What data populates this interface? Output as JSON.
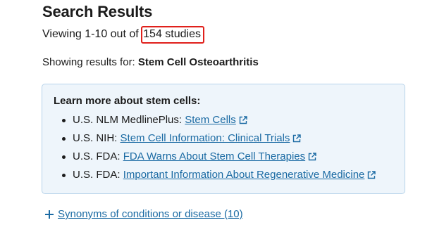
{
  "page": {
    "title": "Search Results",
    "viewing_prefix": "Viewing 1-10 out of",
    "study_count": "154 studies",
    "showing_prefix": "Showing results for:",
    "query": "Stem Cell Osteoarthritis"
  },
  "info_box": {
    "title": "Learn more about stem cells:",
    "items": [
      {
        "source": "U.S. NLM MedlinePlus:",
        "link": "Stem Cells"
      },
      {
        "source": "U.S. NIH:",
        "link": "Stem Cell Information: Clinical Trials"
      },
      {
        "source": "U.S. FDA:",
        "link": "FDA Warns About Stem Cell Therapies"
      },
      {
        "source": "U.S. FDA:",
        "link": "Important Information About Regenerative Medicine"
      }
    ]
  },
  "synonyms": {
    "label": "Synonyms of conditions or disease (10)"
  },
  "colors": {
    "link": "#1a6aa3",
    "highlight_border": "#e0201b",
    "info_bg": "#eef5fb",
    "info_border": "#b7d3ea"
  },
  "icons": {
    "external_link": "external-link-icon",
    "expand": "plus-icon"
  }
}
